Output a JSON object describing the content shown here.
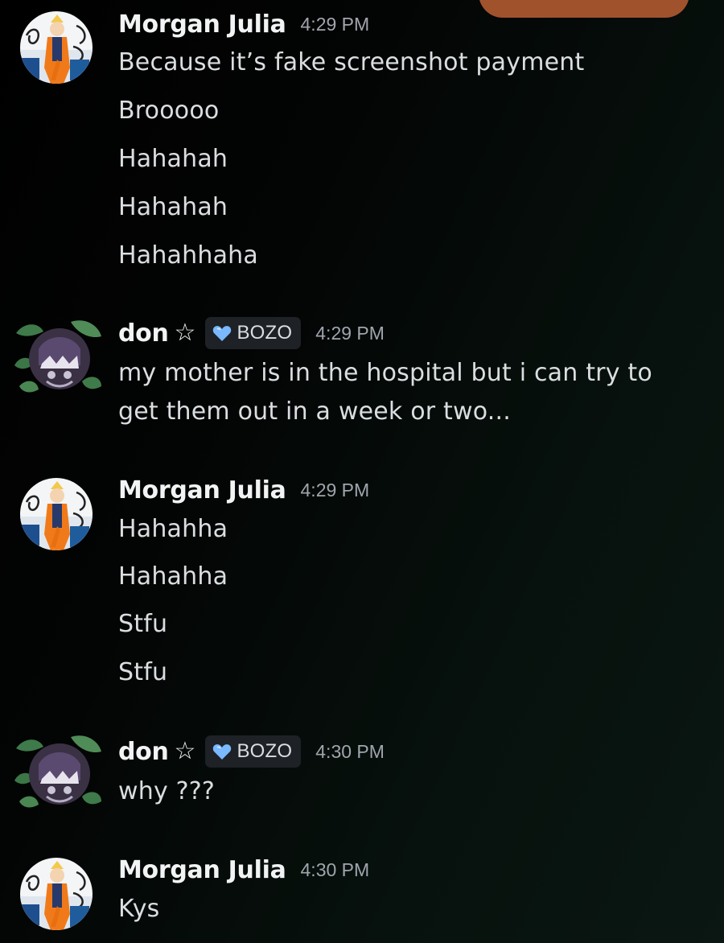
{
  "messages": [
    {
      "author": "Morgan Julia",
      "time": "4:29 PM",
      "avatar": "morgan-avatar",
      "lines": [
        "Because it’s fake screenshot payment",
        "Brooooo",
        "Hahahah",
        "Hahahah",
        "Hahahhaha"
      ]
    },
    {
      "author": "don",
      "star": "☆",
      "badge": "BOZO",
      "time": "4:29 PM",
      "avatar": "don-avatar",
      "lines": [
        "my mother is in the hospital but i can try to",
        "get them out in a week or two..."
      ]
    },
    {
      "author": "Morgan Julia",
      "time": "4:29 PM",
      "avatar": "morgan-avatar",
      "lines": [
        "Hahahha",
        "Hahahha",
        "Stfu",
        "Stfu"
      ]
    },
    {
      "author": "don",
      "star": "☆",
      "badge": "BOZO",
      "time": "4:30 PM",
      "avatar": "don-avatar",
      "lines": [
        "why ???"
      ]
    },
    {
      "author": "Morgan Julia",
      "time": "4:30 PM",
      "avatar": "morgan-avatar",
      "lines": [
        "Kys"
      ]
    }
  ],
  "colors": {
    "background": "#000000",
    "username": "#f2f3f5",
    "message_text": "#dbdee1",
    "timestamp": "#a0a5ad",
    "badge_bg": "#1e2125",
    "badge_heart": "#7ab8ff",
    "top_sheet": "#a0522d"
  }
}
